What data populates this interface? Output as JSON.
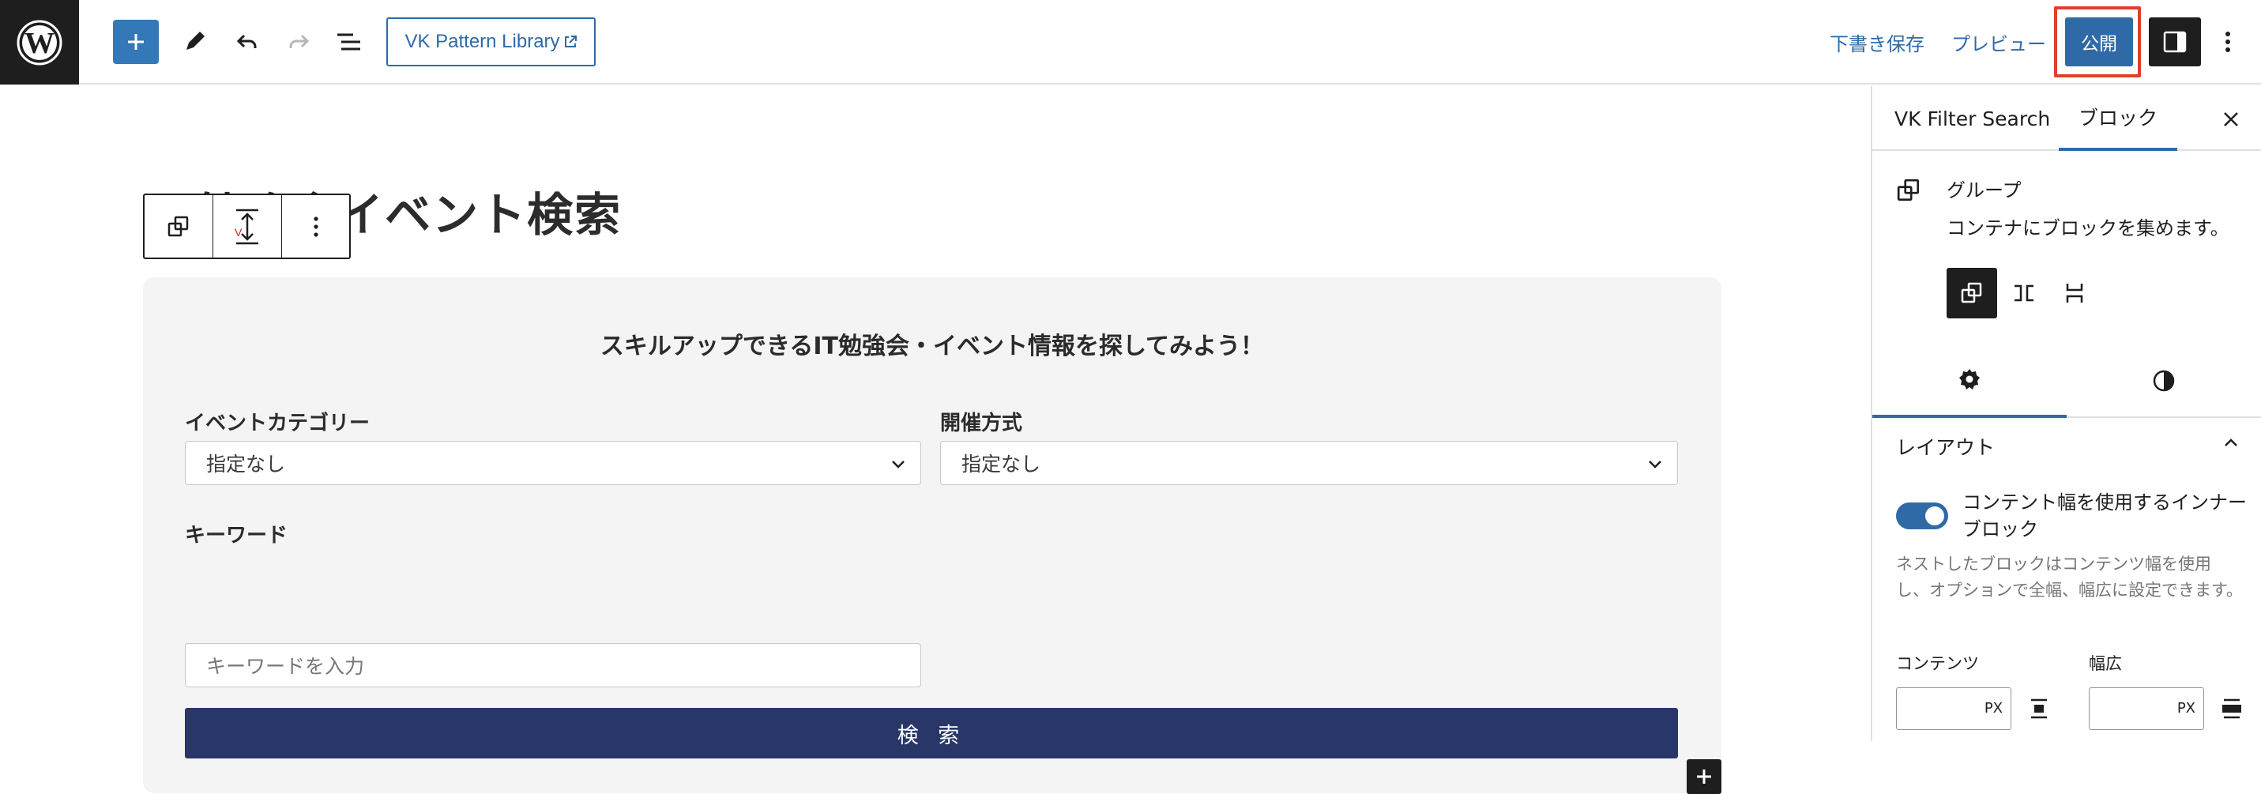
{
  "toolbar": {
    "pattern_library": "VK Pattern Library",
    "save_draft": "下書き保存",
    "preview": "プレビュー",
    "publish": "公開"
  },
  "editor": {
    "title": "IT勉強会イベント検索",
    "group": {
      "heading": "スキルアップできるIT勉強会・イベント情報を探してみよう！",
      "category_label": "イベントカテゴリー",
      "category_value": "指定なし",
      "format_label": "開催方式",
      "format_value": "指定なし",
      "keyword_label": "キーワード",
      "keyword_placeholder": "キーワードを入力",
      "search_button": "検 索"
    }
  },
  "sidebar": {
    "tabs": [
      "VK Filter Search",
      "ブロック"
    ],
    "active_tab": "ブロック",
    "block_name": "グループ",
    "block_description": "コンテナにブロックを集めます。",
    "layout_panel": "レイアウト",
    "toggle_label": "コンテント幅を使用するインナーブロック",
    "toggle_on": true,
    "help_text": "ネストしたブロックはコンテンツ幅を使用し、オプションで全幅、幅広に設定できます。",
    "content_label": "コンテンツ",
    "wide_label": "幅広",
    "unit": "PX"
  },
  "colors": {
    "accent": "#2f6aa6",
    "search_button": "#283767",
    "highlight": "#e0402b"
  },
  "icons": [
    "wordpress-logo-icon",
    "plus-icon",
    "pencil-icon",
    "undo-icon",
    "redo-icon",
    "list-view-icon",
    "external-link-icon",
    "settings-panel-icon",
    "more-vertical-icon",
    "group-block-icon",
    "move-vertical-icon",
    "close-icon",
    "row-icon",
    "stack-icon",
    "gear-icon",
    "contrast-icon",
    "chevron-up-icon",
    "chevron-down-icon",
    "justify-center-icon"
  ]
}
